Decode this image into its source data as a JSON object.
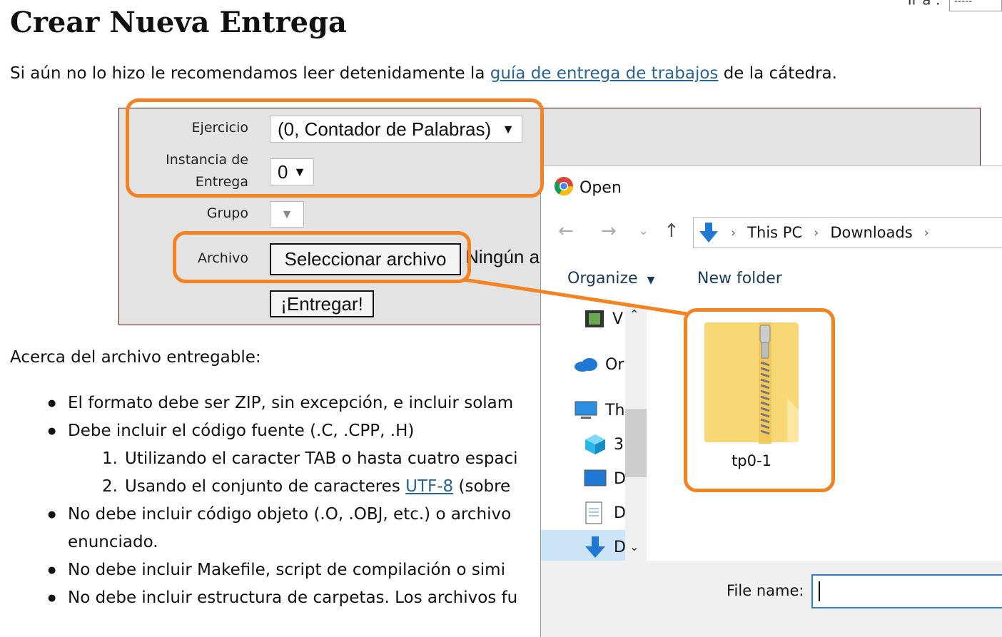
{
  "page": {
    "title": "Crear Nueva Entrega",
    "goto_label": "Ir a :",
    "goto_value": "-----",
    "intro_before": "Si aún no lo hizo le recomendamos leer detenidamente la ",
    "intro_link": "guía de entrega de trabajos",
    "intro_after": " de la cátedra."
  },
  "form": {
    "ejercicio_label": "Ejercicio",
    "ejercicio_value": "(0, Contador de Palabras)",
    "instancia_label_1": "Instancia de",
    "instancia_label_2": "Entrega",
    "instancia_value": "0",
    "grupo_label": "Grupo",
    "grupo_value": "",
    "archivo_label": "Archivo",
    "select_file_button": "Seleccionar archivo",
    "no_file_text": "Ningún a",
    "submit_button": "¡Entregar!"
  },
  "info": {
    "heading": "Acerca del archivo entregable:",
    "bullets": [
      "El formato debe ser ZIP, sin excepción, e incluir solam",
      "Debe incluir el código fuente (.C, .CPP, .H)",
      "No debe incluir código objeto (.O, .OBJ, etc.) o archivo",
      "enunciado.",
      "No debe incluir Makefile, script de compilación o simi",
      "No debe incluir estructura de carpetas. Los archivos fu"
    ],
    "sub_items": [
      {
        "num": "1.",
        "text": "Utilizando el caracter TAB o hasta cuatro espaci"
      },
      {
        "num": "2.",
        "text_before": "Usando el conjunto de caracteres ",
        "link": "UTF-8",
        "text_after": " (sobre"
      }
    ]
  },
  "dialog": {
    "title": "Open",
    "path": [
      "This PC",
      "Downloads"
    ],
    "organize": "Organize",
    "new_folder": "New folder",
    "tree": [
      "V",
      "Or",
      "Th",
      "3",
      "D",
      "D",
      "D"
    ],
    "file": "tp0-1",
    "file_name_label": "File name:",
    "file_name_value": ""
  },
  "colors": {
    "highlight": "#f58220",
    "link": "#2a6496",
    "form_bg": "#e3e3e3",
    "folder": "#f8d775"
  }
}
